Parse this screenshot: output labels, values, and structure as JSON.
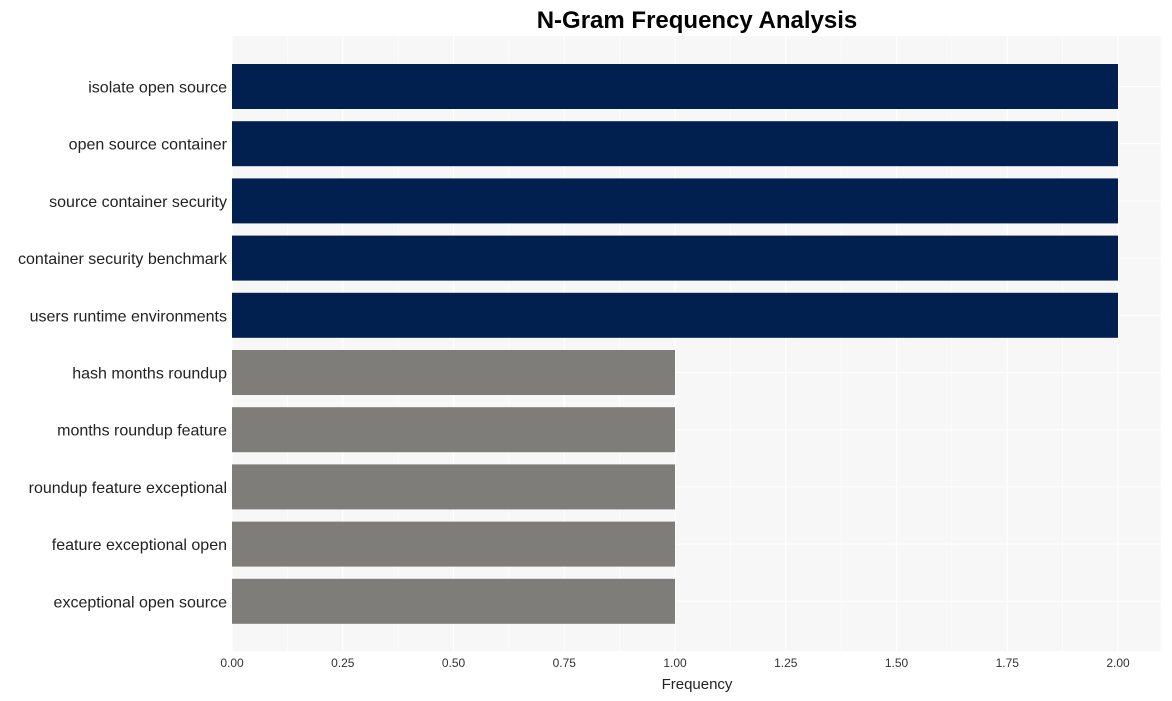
{
  "chart_data": {
    "type": "bar",
    "orientation": "horizontal",
    "title": "N-Gram Frequency Analysis",
    "xlabel": "Frequency",
    "ylabel": "",
    "xlim": [
      0,
      2.1
    ],
    "grid": true,
    "legend": "none",
    "x_ticks": [
      "0.00",
      "0.25",
      "0.50",
      "0.75",
      "1.00",
      "1.25",
      "1.50",
      "1.75",
      "2.00"
    ],
    "x_tick_values": [
      0,
      0.25,
      0.5,
      0.75,
      1.0,
      1.25,
      1.5,
      1.75,
      2.0
    ],
    "categories": [
      "isolate open source",
      "open source container",
      "source container security",
      "container security benchmark",
      "users runtime environments",
      "hash months roundup",
      "months roundup feature",
      "roundup feature exceptional",
      "feature exceptional open",
      "exceptional open source"
    ],
    "values": [
      2,
      2,
      2,
      2,
      2,
      1,
      1,
      1,
      1,
      1
    ],
    "colors": {
      "high": "#012050",
      "low": "#7f7d79",
      "panel": "#f7f7f7",
      "grid": "#ffffff"
    }
  }
}
